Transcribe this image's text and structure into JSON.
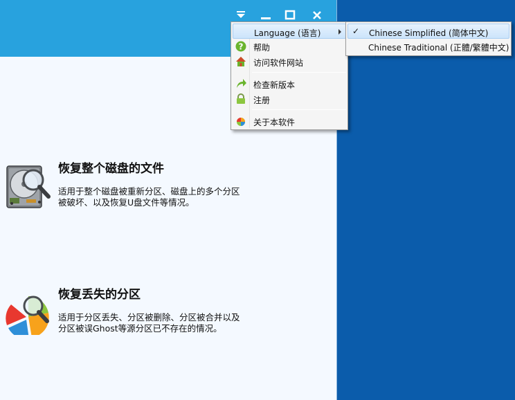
{
  "window": {
    "titlebar_buttons": [
      {
        "name": "menu-dropdown-icon"
      },
      {
        "name": "minimize-icon"
      },
      {
        "name": "maximize-icon"
      },
      {
        "name": "close-icon"
      }
    ]
  },
  "features": [
    {
      "title": "恢复整个磁盘的文件",
      "description": "适用于整个磁盘被重新分区、磁盘上的多个分区被破坏、以及恢复U盘文件等情况。",
      "icon": "hard-disk-magnifier-icon"
    },
    {
      "title": "恢复丢失的分区",
      "description": "适用于分区丢失、分区被删除、分区被合并以及分区被误Ghost等源分区已不存在的情况。",
      "icon": "pie-partition-magnifier-icon"
    }
  ],
  "menu": {
    "items": [
      {
        "label": "Language (语言)",
        "icon": "",
        "submenu": true
      },
      {
        "label": "帮助",
        "icon": "help-icon"
      },
      {
        "label": "访问软件网站",
        "icon": "home-icon"
      },
      {
        "label": "检查新版本",
        "icon": "update-arrow-icon"
      },
      {
        "label": "注册",
        "icon": "lock-icon"
      },
      {
        "label": "关于本软件",
        "icon": "about-icon"
      }
    ]
  },
  "language_submenu": {
    "items": [
      {
        "label": "Chinese Simplified (简体中文)",
        "checked": true,
        "check_glyph": "✓"
      },
      {
        "label": "Chinese Traditional (正體/繁體中文)",
        "checked": false
      }
    ]
  },
  "colors": {
    "titlebar": "#28a2de",
    "desktop": "#0b5cab",
    "window_body": "#f4f9ff",
    "menu_bg": "#f5f5f5"
  }
}
